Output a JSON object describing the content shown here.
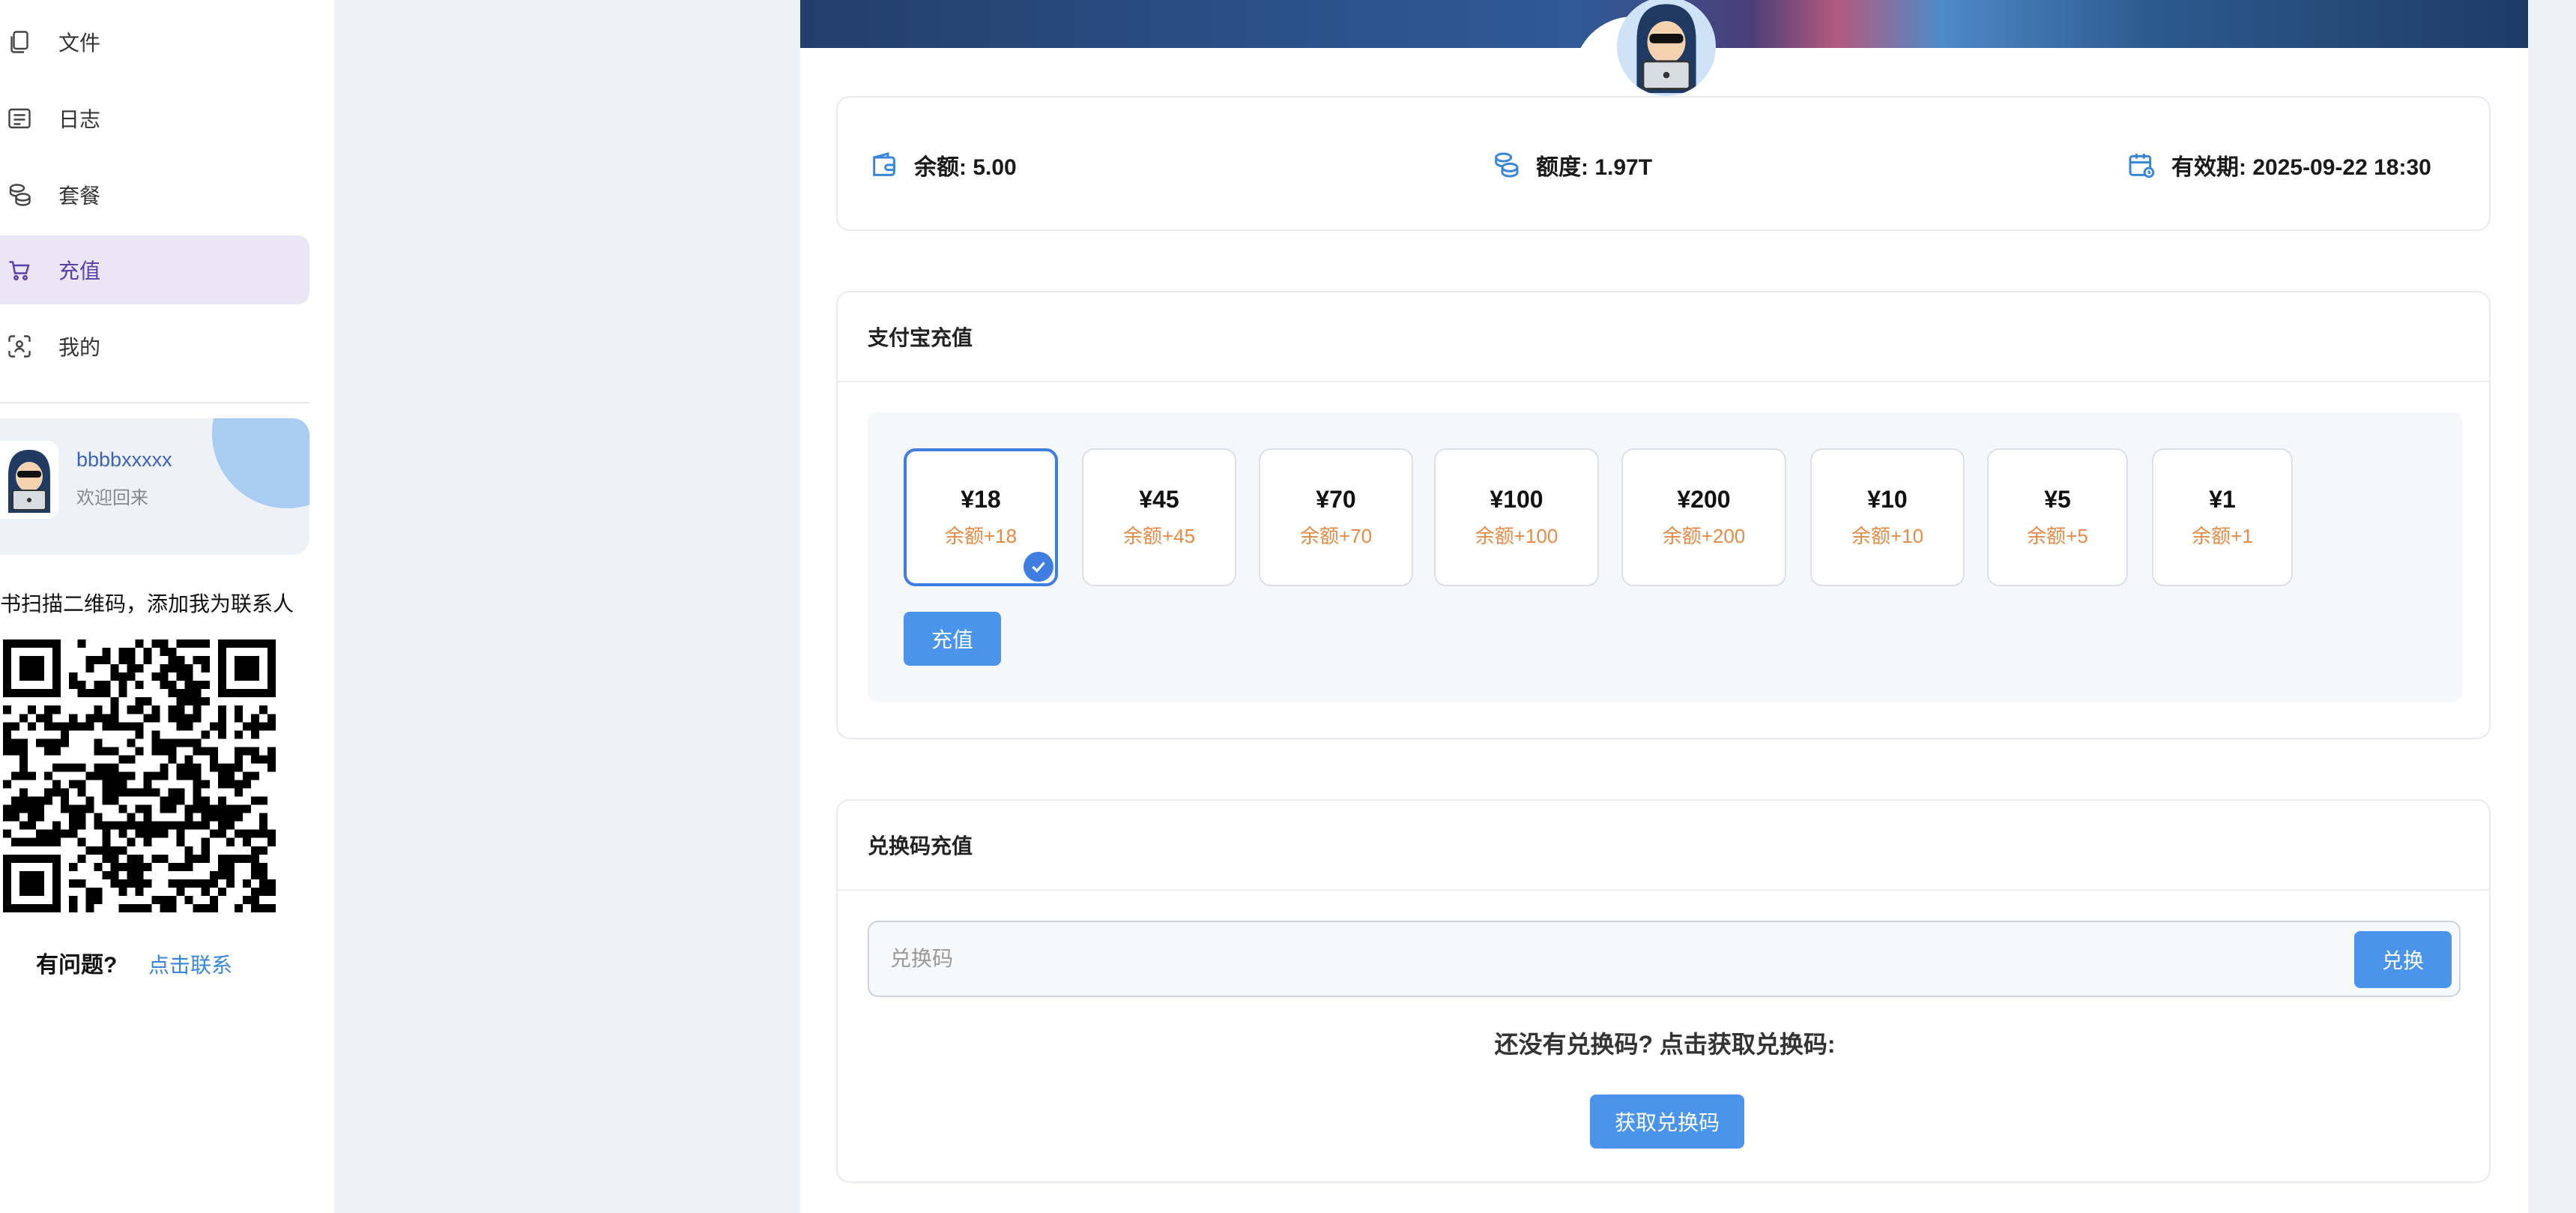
{
  "sidebar": {
    "items": [
      {
        "label": "文件",
        "icon": "files-icon"
      },
      {
        "label": "日志",
        "icon": "list-icon"
      },
      {
        "label": "套餐",
        "icon": "coins-icon"
      },
      {
        "label": "充值",
        "icon": "cart-icon",
        "active": true
      },
      {
        "label": "我的",
        "icon": "scan-user-icon"
      }
    ],
    "user": {
      "name": "bbbbxxxxx",
      "greeting": "欢迎回来"
    },
    "qr_tip": "书扫描二维码，添加我为联系人",
    "help_text": "有问题?",
    "help_link": "点击联系"
  },
  "stats": {
    "balance": "余额:  5.00",
    "quota": "额度:  1.97T",
    "expiry": "有效期:  2025-09-22 18:30"
  },
  "alipay": {
    "title": "支付宝充值",
    "plans": [
      {
        "price": "¥18",
        "bonus": "余额+18",
        "selected": true
      },
      {
        "price": "¥45",
        "bonus": "余额+45"
      },
      {
        "price": "¥70",
        "bonus": "余额+70"
      },
      {
        "price": "¥100",
        "bonus": "余额+100"
      },
      {
        "price": "¥200",
        "bonus": "余额+200"
      },
      {
        "price": "¥10",
        "bonus": "余额+10"
      },
      {
        "price": "¥5",
        "bonus": "余额+5"
      },
      {
        "price": "¥1",
        "bonus": "余额+1"
      }
    ],
    "recharge_label": "充值"
  },
  "code": {
    "title": "兑换码充值",
    "placeholder": "兑换码",
    "exchange_label": "兑换",
    "tip": "还没有兑换码?  点击获取兑换码:",
    "get_label": "获取兑换码"
  },
  "colors": {
    "accent": "#4b94ec",
    "active_nav_bg": "#ebe6f4",
    "bonus_text": "#e58a47",
    "selected_border": "#3f7de0"
  }
}
